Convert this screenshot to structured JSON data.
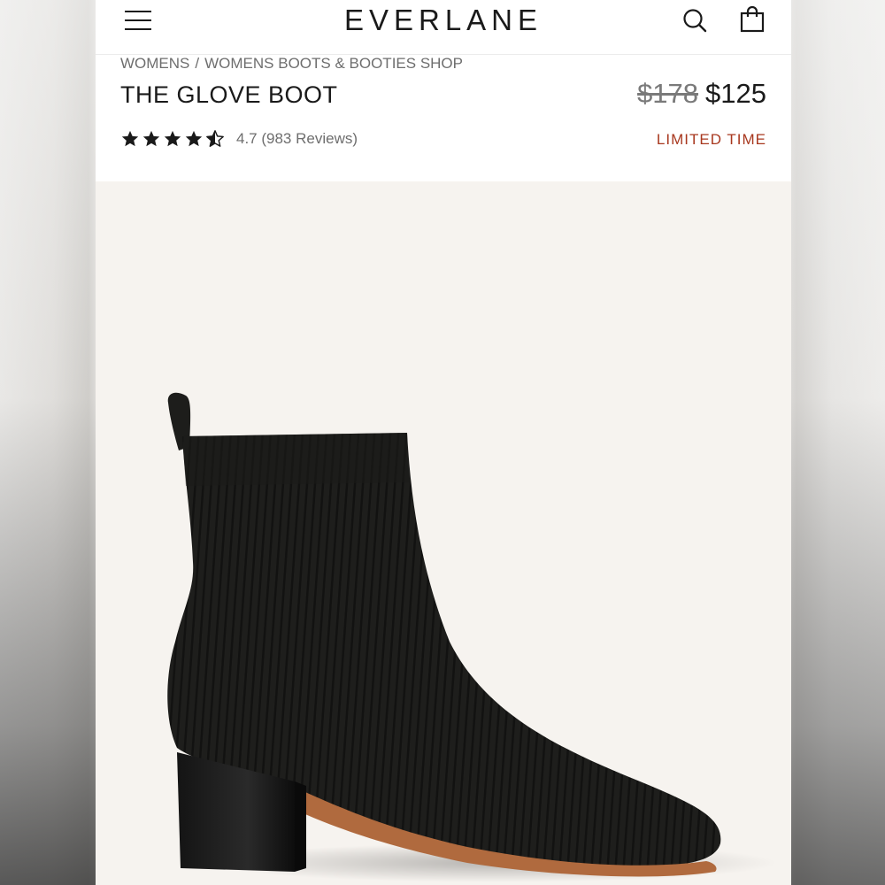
{
  "brand": {
    "logo_text": "EVERLANE"
  },
  "header": {
    "menu_icon": "hamburger-menu-icon",
    "search_icon": "search-icon",
    "bag_icon": "shopping-bag-icon"
  },
  "breadcrumb": {
    "items": [
      "WOMENS",
      "WOMENS BOOTS & BOOTIES SHOP"
    ],
    "separator": "/"
  },
  "product": {
    "title": "THE GLOVE BOOT",
    "original_price": "$178",
    "sale_price": "$125",
    "rating_value": 4.7,
    "rating_text": "4.7 (983 Reviews)",
    "promo_label": "LIMITED TIME",
    "image_description_icon": "product-photo"
  },
  "colors": {
    "promo": "#a8381f",
    "text": "#1a1a1a",
    "muted": "#6e6e6e",
    "image_background": "#f6f3ef",
    "boot": "#1c1c1a",
    "sole": "#b06a3e"
  }
}
